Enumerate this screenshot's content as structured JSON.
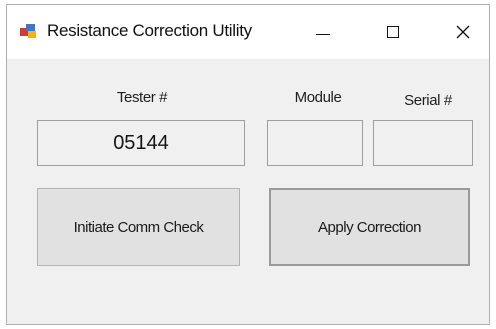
{
  "window": {
    "title": "Resistance Correction Utility",
    "icon": "app-window-icon",
    "controls": {
      "minimize": "minimize-icon",
      "maximize": "maximize-icon",
      "close": "close-icon"
    }
  },
  "form": {
    "tester": {
      "label": "Tester #",
      "value": "05144"
    },
    "module": {
      "label": "Module",
      "value": ""
    },
    "serial": {
      "label": "Serial #",
      "value": ""
    }
  },
  "buttons": {
    "comm_check": "Initiate Comm Check",
    "apply_correction": "Apply Correction"
  },
  "colors": {
    "window_bg": "#f0f0f0",
    "titlebar_bg": "#ffffff",
    "button_bg": "#e1e1e1"
  }
}
